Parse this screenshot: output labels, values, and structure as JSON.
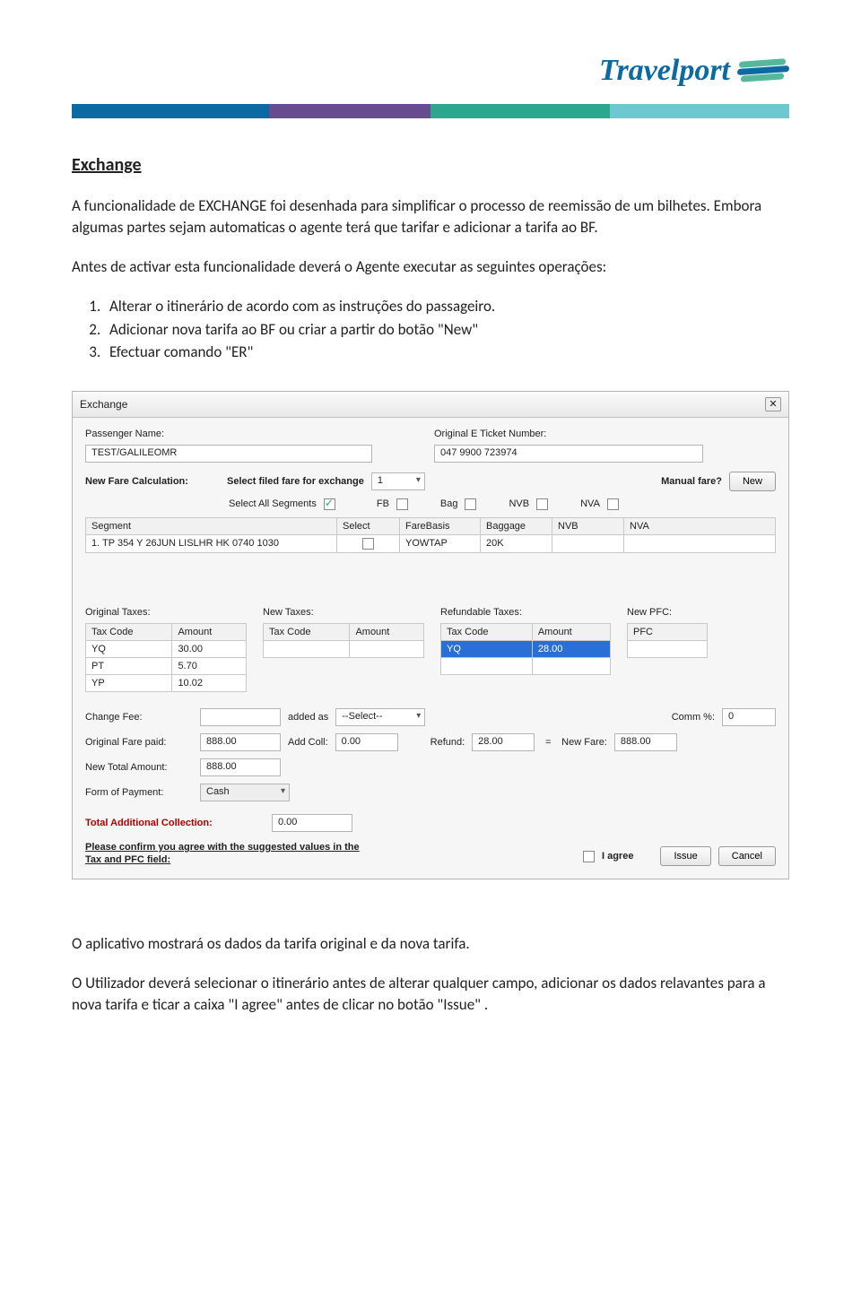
{
  "logo": {
    "text": "Travelport"
  },
  "doc": {
    "title": "Exchange",
    "para1": "A funcionalidade de EXCHANGE foi desenhada para simplificar o processo de reemissão de um bilhetes. Embora algumas partes sejam automaticas o agente terá que tarifar e adicionar a tarifa ao BF.",
    "para2": "Antes de activar esta funcionalidade deverá o Agente executar as seguintes operações:",
    "steps": {
      "s1": "Alterar o itinerário de acordo com as instruções do passageiro.",
      "s2": "Adicionar nova tarifa ao BF ou criar a partir do botão \"New\"",
      "s3": "Efectuar comando \"ER\""
    },
    "para3": "O aplicativo mostrará os dados da tarifa original e da nova tarifa.",
    "para4": "O Utilizador deverá selecionar o itinerário antes de alterar qualquer campo, adicionar os dados relavantes para a nova tarifa e ticar a caixa \"I agree\" antes de clicar no botão \"Issue\" ."
  },
  "dialog": {
    "title": "Exchange",
    "pax_label": "Passenger Name:",
    "pax_value": "TEST/GALILEOMR",
    "tkt_label": "Original E Ticket Number:",
    "tkt_value": "047 9900 723974",
    "newfare_label": "New Fare Calculation:",
    "selectfiled_label": "Select filed fare for exchange",
    "filed_value": "1",
    "manual_label": "Manual fare?",
    "new_btn": "New",
    "selectall_label": "Select All Segments",
    "fb_label": "FB",
    "bag_label": "Bag",
    "nvb_label": "NVB",
    "nva_label": "NVA",
    "seg_hdr": {
      "seg": "Segment",
      "select": "Select",
      "fb": "FareBasis",
      "bag": "Baggage",
      "nvb": "NVB",
      "nva": "NVA"
    },
    "seg_row": {
      "text": "1. TP  354 Y 26JUN LISLHR HK 0740 1030",
      "fb": "YOWTAP",
      "bag": "20K"
    },
    "orig_tax_label": "Original Taxes:",
    "new_tax_label": "New Taxes:",
    "ref_tax_label": "Refundable Taxes:",
    "new_pfc_label": "New PFC:",
    "tax_hdr_code": "Tax Code",
    "tax_hdr_amt": "Amount",
    "pfc_hdr": "PFC",
    "orig_taxes": [
      {
        "code": "YQ",
        "amt": "30.00"
      },
      {
        "code": "PT",
        "amt": "5.70"
      },
      {
        "code": "YP",
        "amt": "10.02"
      }
    ],
    "ref_taxes": [
      {
        "code": "YQ",
        "amt": "28.00"
      }
    ],
    "change_fee_label": "Change Fee:",
    "added_as_label": "added as",
    "added_as_value": "--Select--",
    "comm_label": "Comm %:",
    "comm_value": "0",
    "orig_paid_label": "Original Fare paid:",
    "orig_paid_value": "888.00",
    "addcoll_label": "Add Coll:",
    "addcoll_value": "0.00",
    "refund_label": "Refund:",
    "refund_value": "28.00",
    "eq": "=",
    "newfare_val_label": "New Fare:",
    "newfare_value": "888.00",
    "newtotal_label": "New Total Amount:",
    "newtotal_value": "888.00",
    "fop_label": "Form of Payment:",
    "fop_value": "Cash",
    "total_add_label": "Total Additional Collection:",
    "total_add_value": "0.00",
    "confirm_text": "Please confirm you agree with the suggested values in the Tax and PFC field:",
    "agree_label": "I agree",
    "issue_btn": "Issue",
    "cancel_btn": "Cancel"
  }
}
